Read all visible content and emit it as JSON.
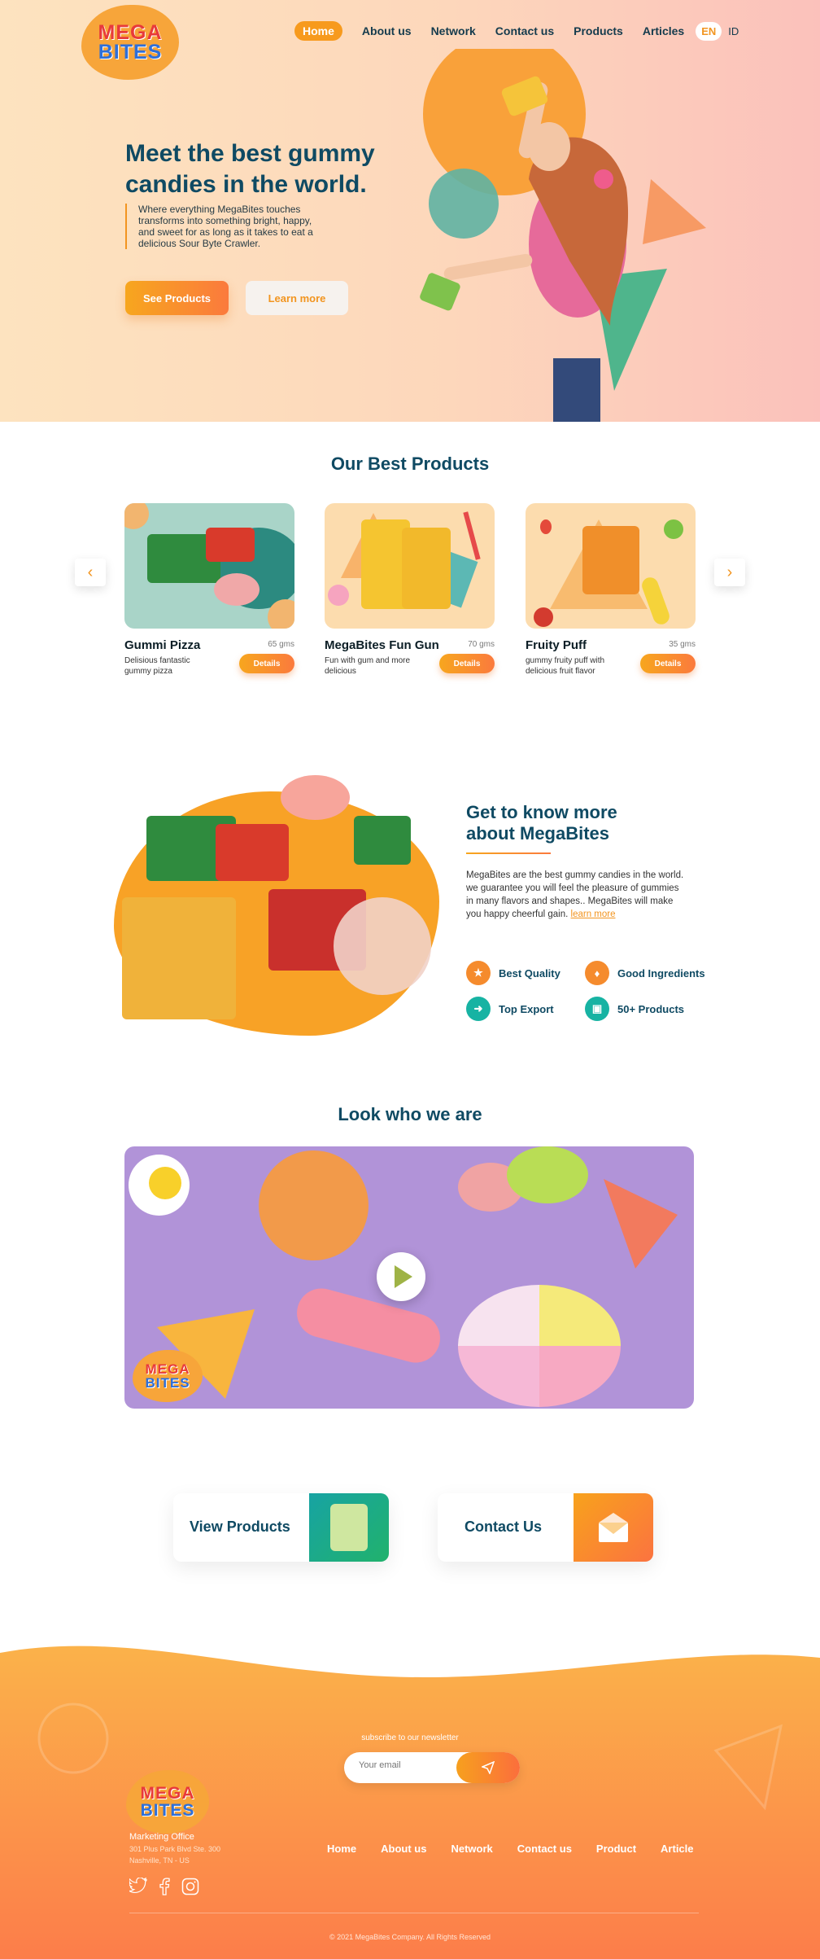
{
  "brand": {
    "logo_line1": "MEGA",
    "logo_line2": "BITES"
  },
  "nav": {
    "items": [
      "Home",
      "About us",
      "Network",
      "Contact us",
      "Products",
      "Articles"
    ],
    "lang_en": "EN",
    "lang_id": "ID"
  },
  "hero": {
    "title": "Meet the best gummy candies in the world.",
    "text": "Where everything MegaBites touches transforms into something bright, happy, and sweet for as long as it takes to eat a delicious Sour Byte Crawler.",
    "primary_button": "See Products",
    "secondary_button": "Learn more"
  },
  "products": {
    "title": "Our Best Products",
    "items": [
      {
        "name": "Gummi Pizza",
        "weight": "65 gms",
        "desc": "Delisious fantastic gummy pizza",
        "button": "Details"
      },
      {
        "name": "MegaBites Fun Gun",
        "weight": "70 gms",
        "desc": "Fun with gum and more delicious",
        "button": "Details"
      },
      {
        "name": "Fruity Puff",
        "weight": "35 gms",
        "desc": "gummy fruity puff with delicious fruit flavor",
        "button": "Details"
      }
    ]
  },
  "about": {
    "title": "Get to know more about MegaBites",
    "text": "MegaBites are the best gummy candies in the world. we guarantee you will feel the pleasure of gummies in many flavors and shapes.. MegaBites will make you happy cheerful gain.",
    "link": "learn more",
    "features": [
      "Best Quality",
      "Good Ingredients",
      "Top Export",
      "50+ Products"
    ]
  },
  "video": {
    "title": "Look who we are"
  },
  "cta": {
    "view_products": "View Products",
    "contact_us": "Contact Us"
  },
  "footer": {
    "newsletter_label": "subscribe to our newsletter",
    "email_placeholder": "Your email",
    "office_title": "Marketing Office",
    "address_line1": "301 Plus Park Blvd Ste. 300",
    "address_line2": "Nashville, TN - US",
    "nav": [
      "Home",
      "About us",
      "Network",
      "Contact us",
      "Product",
      "Article"
    ],
    "copyright": "© 2021 MegaBites Company. All Rights Reserved"
  },
  "colors": {
    "accent": "#f29520",
    "navy": "#0f4a63",
    "teal": "#17b3a3"
  }
}
